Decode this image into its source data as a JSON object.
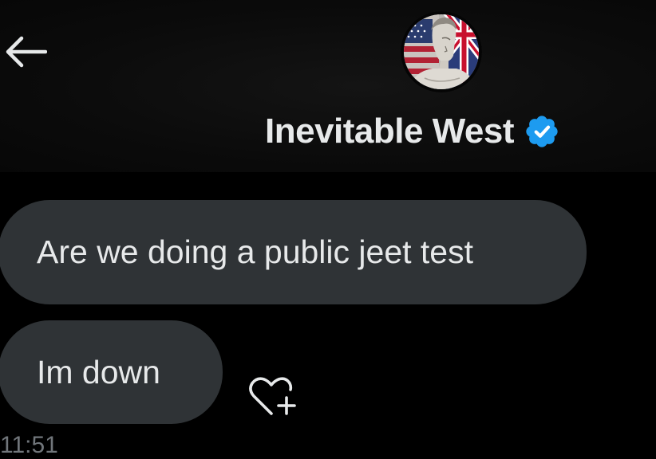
{
  "header": {
    "back_icon": "arrow-left-icon",
    "contact_name": "Inevitable West",
    "verified_icon": "verified-badge-icon",
    "avatar_icon": "avatar-statue-flags",
    "colors": {
      "verified": "#1d9bf0",
      "background": "#0b0b0b"
    }
  },
  "messages": [
    {
      "text": "Are we doing a public jeet test"
    },
    {
      "text": "Im down"
    }
  ],
  "react_icon": "heart-add-icon",
  "timestamp": "11:51",
  "colors": {
    "bubble": "#2f3336",
    "text": "#e7e9ea",
    "muted": "#71767b"
  }
}
